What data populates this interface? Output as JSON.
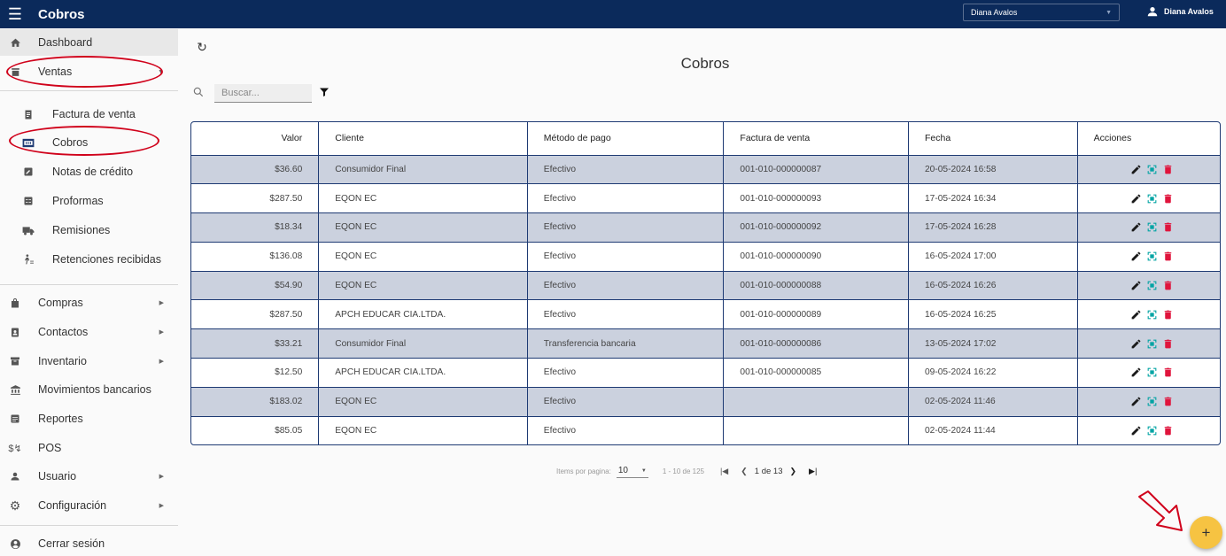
{
  "app": {
    "title": "Cobros",
    "user_select": "Diana Avalos",
    "user_name": "Diana Avalos"
  },
  "sidebar": {
    "top": [
      {
        "label": "Dashboard",
        "icon": "home-icon"
      },
      {
        "label": "Ventas",
        "icon": "store-icon"
      }
    ],
    "ventas_sub": [
      {
        "label": "Factura de venta",
        "icon": "receipt-icon"
      },
      {
        "label": "Cobros",
        "icon": "payments-icon"
      },
      {
        "label": "Notas de crédito",
        "icon": "note-icon"
      },
      {
        "label": "Proformas",
        "icon": "calculator-icon"
      },
      {
        "label": "Remisiones",
        "icon": "truck-icon"
      },
      {
        "label": "Retenciones recibidas",
        "icon": "withholding-icon"
      }
    ],
    "main": [
      {
        "label": "Compras",
        "icon": "bag-icon"
      },
      {
        "label": "Contactos",
        "icon": "contacts-icon"
      },
      {
        "label": "Inventario",
        "icon": "inventory-icon"
      },
      {
        "label": "Movimientos bancarios",
        "icon": "bank-icon"
      },
      {
        "label": "Reportes",
        "icon": "report-icon"
      },
      {
        "label": "POS",
        "icon": "pos-icon"
      },
      {
        "label": "Usuario",
        "icon": "user-icon"
      },
      {
        "label": "Configuración",
        "icon": "settings-icon"
      }
    ],
    "logout": {
      "label": "Cerrar sesión",
      "icon": "account-circle-icon"
    }
  },
  "main": {
    "title": "Cobros",
    "search_placeholder": "Buscar...",
    "columns": [
      "Valor",
      "Cliente",
      "Método de pago",
      "Factura de venta",
      "Fecha",
      "Acciones"
    ],
    "rows": [
      [
        "$36.60",
        "Consumidor Final",
        "Efectivo",
        "001-010-000000087",
        "20-05-2024 16:58"
      ],
      [
        "$287.50",
        "EQON EC",
        "Efectivo",
        "001-010-000000093",
        "17-05-2024 16:34"
      ],
      [
        "$18.34",
        "EQON EC",
        "Efectivo",
        "001-010-000000092",
        "17-05-2024 16:28"
      ],
      [
        "$136.08",
        "EQON EC",
        "Efectivo",
        "001-010-000000090",
        "16-05-2024 17:00"
      ],
      [
        "$54.90",
        "EQON EC",
        "Efectivo",
        "001-010-000000088",
        "16-05-2024 16:26"
      ],
      [
        "$287.50",
        "APCH EDUCAR CIA.LTDA.",
        "Efectivo",
        "001-010-000000089",
        "16-05-2024 16:25"
      ],
      [
        "$33.21",
        "Consumidor Final",
        "Transferencia bancaria",
        "001-010-000000086",
        "13-05-2024 17:02"
      ],
      [
        "$12.50",
        "APCH EDUCAR CIA.LTDA.",
        "Efectivo",
        "001-010-000000085",
        "09-05-2024 16:22"
      ],
      [
        "$183.02",
        "EQON EC",
        "Efectivo",
        "",
        "02-05-2024 11:46"
      ],
      [
        "$85.05",
        "EQON EC",
        "Efectivo",
        "",
        "02-05-2024 11:44"
      ]
    ],
    "pagination": {
      "items_label": "Items por pagina:",
      "page_size": "10",
      "range": "1 - 10 de 125",
      "page": "1 de 13"
    }
  },
  "fab": {
    "label": "+"
  },
  "colors": {
    "topbar": "#0b2a5b",
    "row_shade": "#cbd1de",
    "edit": "#1a1a1a",
    "view": "#00a3a3",
    "delete": "#e0143c",
    "fab": "#f6c342",
    "annotation": "#d0021b"
  }
}
